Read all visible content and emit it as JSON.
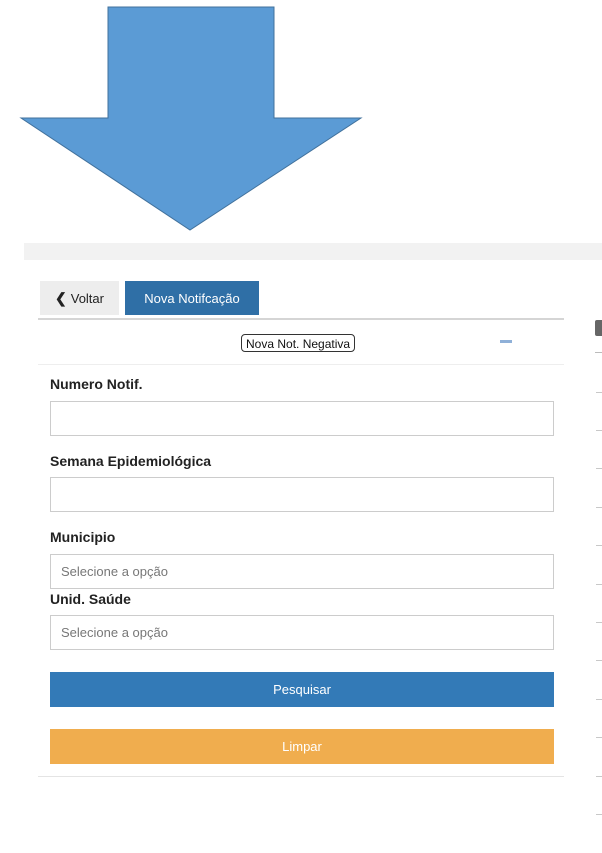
{
  "colors": {
    "arrow_fill": "#5b9bd5",
    "arrow_stroke": "#41719c",
    "primary": "#337ab7",
    "header_button": "#2f6fa6",
    "warning": "#f0ad4e"
  },
  "nav": {
    "back_icon": "chevron-left-icon",
    "back_label": "Voltar",
    "new_label": "Nova Notifcação"
  },
  "panel": {
    "negative_label": "Nova Not. Negativa",
    "collapse_icon": "minus-icon"
  },
  "form": {
    "numero_label": "Numero Notif.",
    "numero_value": "",
    "semana_label": "Semana Epidemiológica",
    "semana_value": "",
    "municipio_label": "Municipio",
    "municipio_placeholder": "Selecione a opção",
    "unid_label": "Unid. Saúde",
    "unid_placeholder": "Selecione a opção"
  },
  "actions": {
    "search_label": "Pesquisar",
    "clear_label": "Limpar"
  }
}
